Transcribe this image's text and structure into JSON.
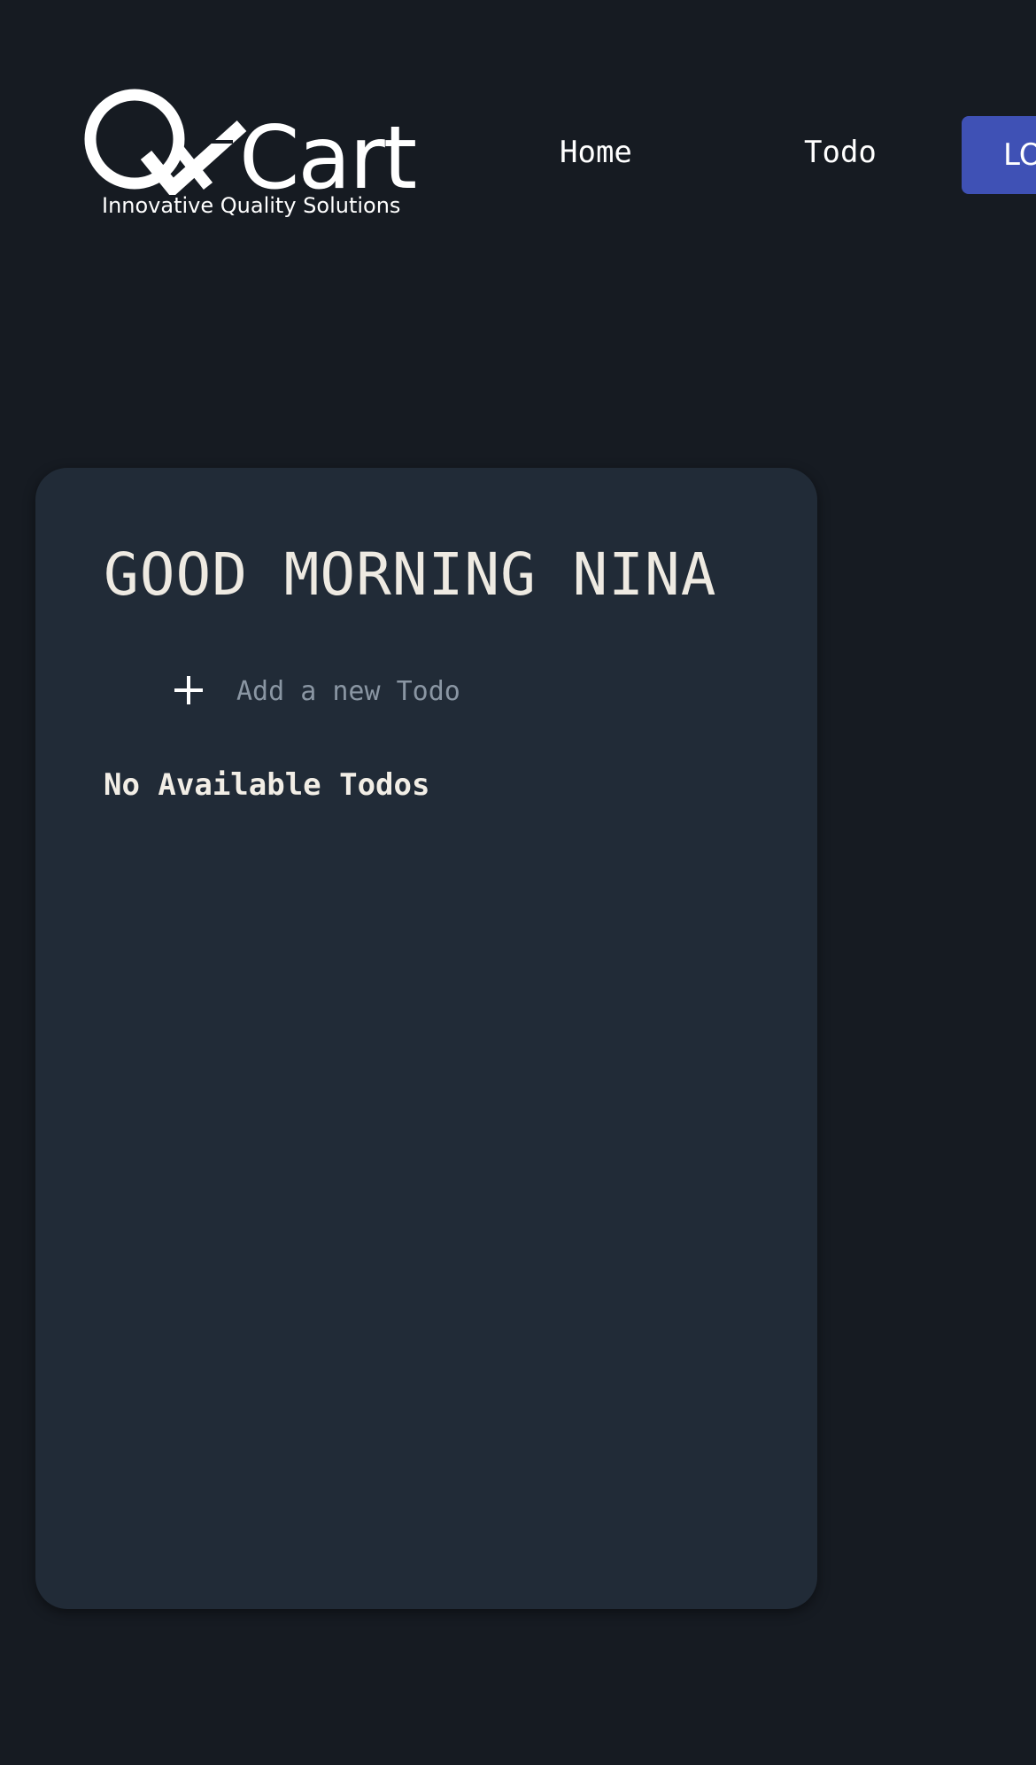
{
  "header": {
    "logo": {
      "wordmark": "Cart",
      "tagline": "Innovative Quality Solutions"
    },
    "nav": {
      "home_label": "Home",
      "todo_label": "Todo"
    },
    "logout_label": "LOGOUT"
  },
  "todo_card": {
    "greeting": "GOOD MORNING NINA",
    "add_placeholder": "Add a new Todo",
    "empty_message": "No Available Todos"
  },
  "icons": {
    "add": "plus-icon"
  },
  "colors": {
    "background": "#161b22",
    "card": "#212b37",
    "accent": "#3f51b5",
    "text": "#eeeae2"
  }
}
